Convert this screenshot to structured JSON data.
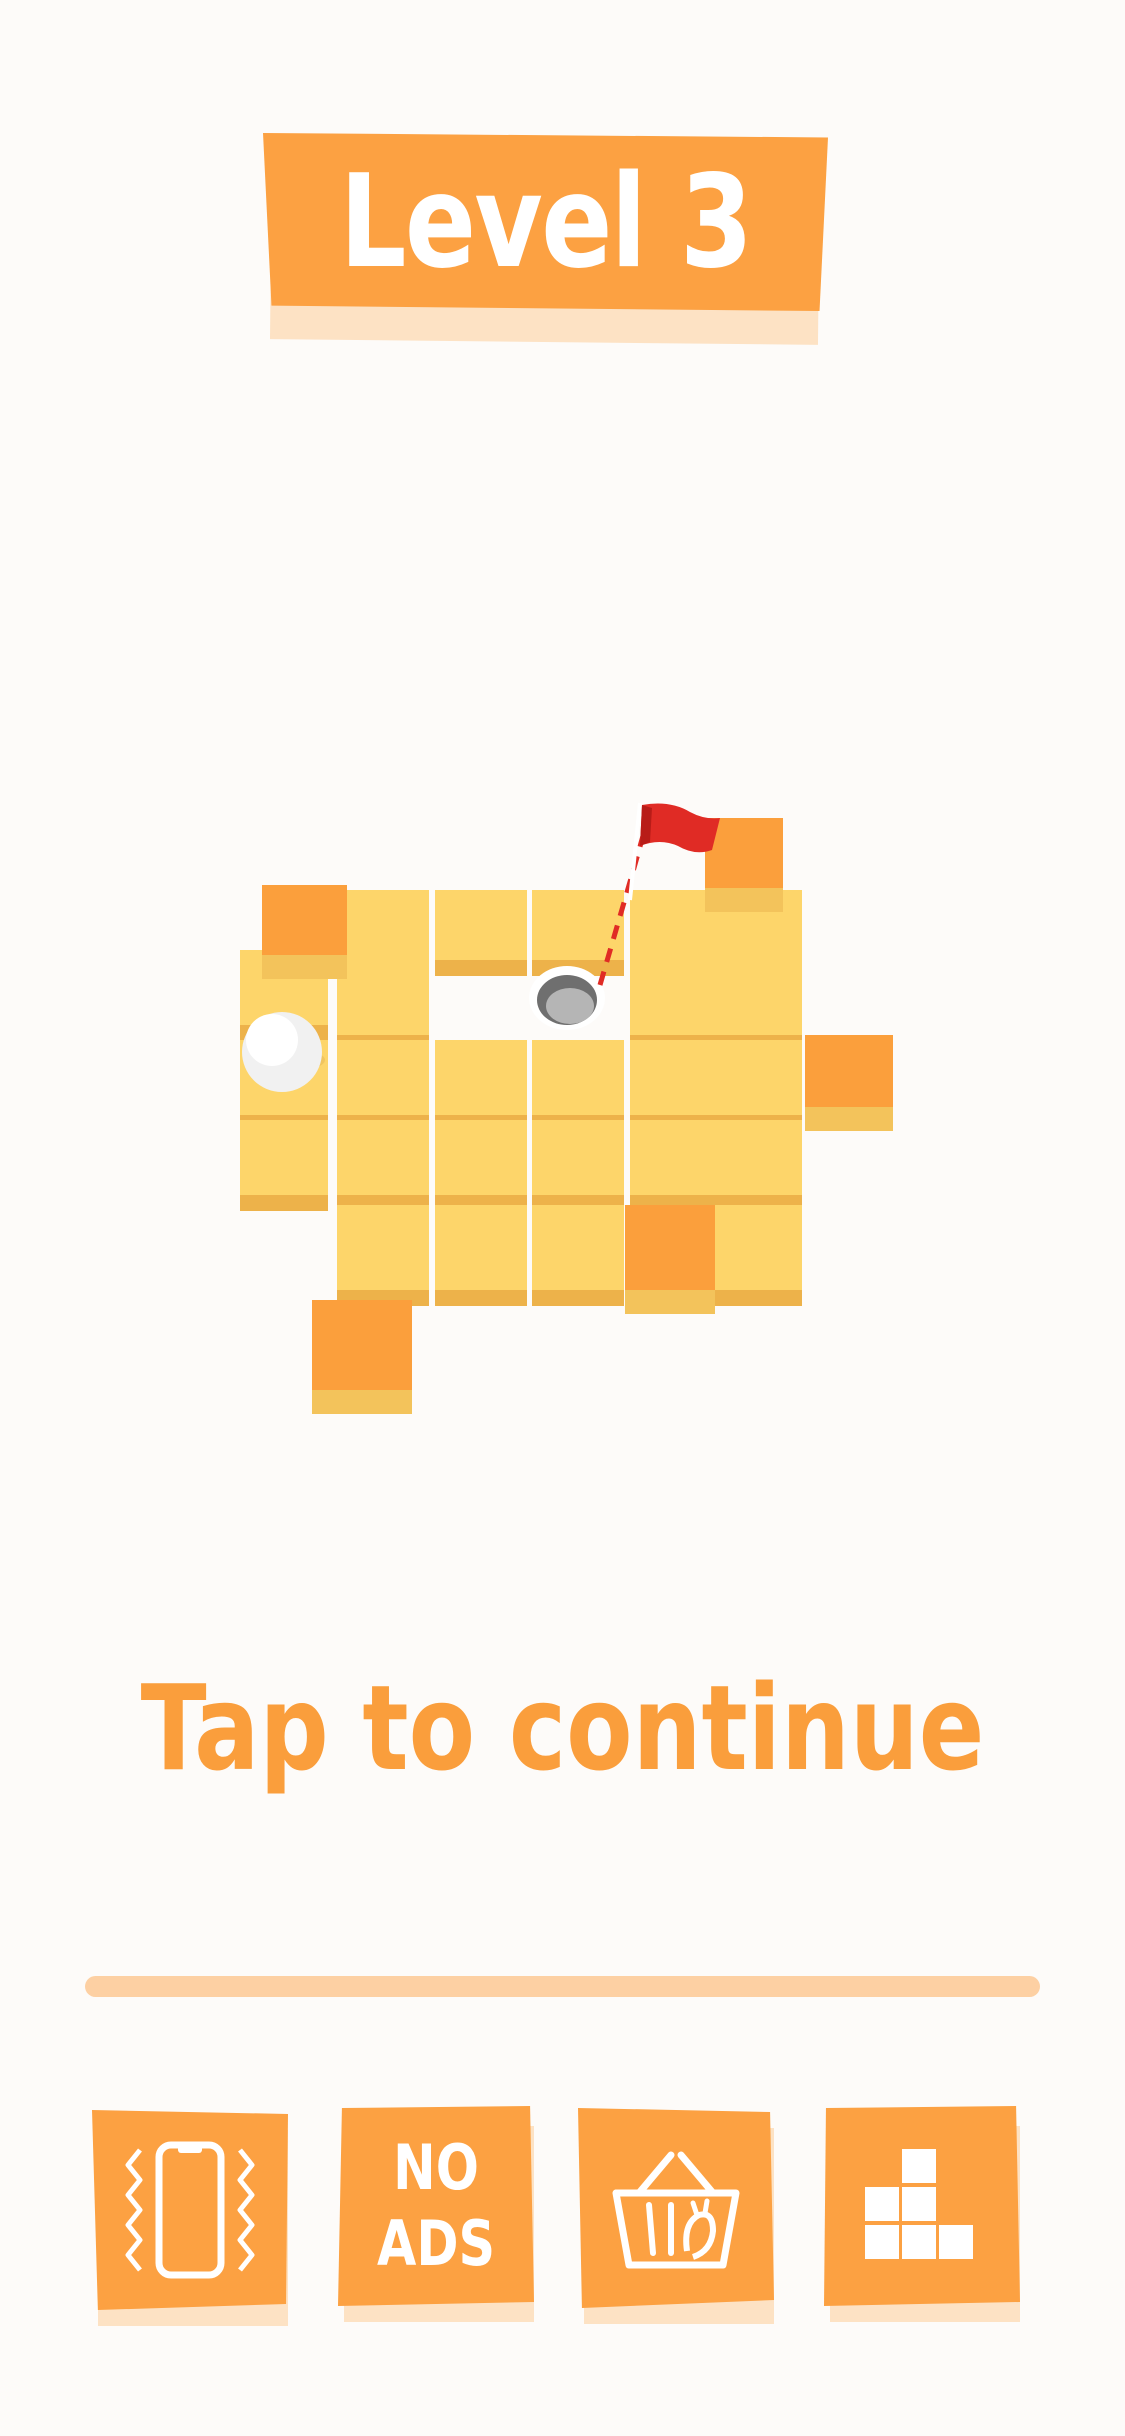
{
  "header": {
    "level_label": "Level 3"
  },
  "prompt": {
    "tap_text": "Tap to continue"
  },
  "progress": {
    "fraction": 0.0
  },
  "colors": {
    "accent": "#fca142",
    "accent_light": "#fde2c4",
    "progress_track": "#fdd0a3",
    "tile_top": "#fdd56a",
    "tile_side": "#edb24a",
    "block_top": "#fb9f3c",
    "flag": "#e02b25",
    "background": "#fdfbf9"
  },
  "toolbar": {
    "vibration": {
      "icon": "vibration-phone-icon"
    },
    "no_ads": {
      "line1": "NO",
      "line2": "ADS"
    },
    "shop": {
      "icon": "shopping-basket-icon"
    },
    "levels": {
      "icon": "blocks-stairs-icon"
    }
  }
}
